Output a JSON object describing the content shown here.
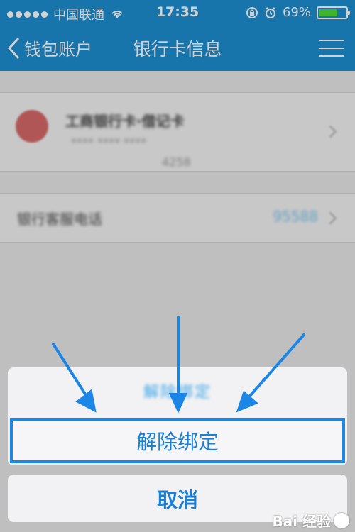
{
  "status_bar": {
    "signal_filled": 5,
    "carrier": "中国联通",
    "time": "17:35",
    "battery_percent": "69%",
    "battery_level": 0.69,
    "icons": [
      "signal-dots-icon",
      "wifi-icon",
      "rotation-lock-icon",
      "alarm-icon",
      "battery-icon"
    ]
  },
  "nav": {
    "back_label": "钱包账户",
    "title": "银行卡信息",
    "menu_icon": "menu-icon"
  },
  "card": {
    "bank_name": "工商银行卡·借记卡",
    "card_number": "**** **** ****",
    "card_tail": "4258"
  },
  "phone_row": {
    "label": "银行客服电话",
    "value": "95588"
  },
  "action_sheet": {
    "title": "解除绑定",
    "unbind_label": "解除绑定",
    "cancel_label": "取消"
  },
  "colors": {
    "nav_blue": "#1d8fd2",
    "action_blue": "#1a7fd6",
    "highlight_border": "#1b86e6"
  },
  "watermark": {
    "text": "Bai 经验"
  }
}
